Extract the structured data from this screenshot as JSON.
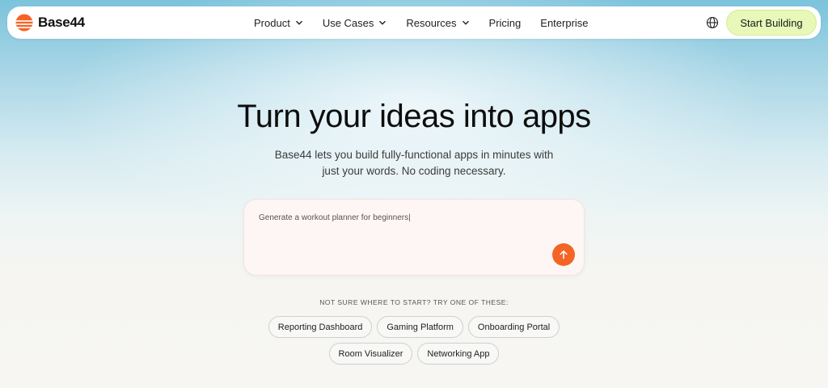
{
  "brand": {
    "name": "Base44",
    "logo_icon": "sun-stripes-logo",
    "accent": "#f46425"
  },
  "nav": {
    "items": [
      {
        "label": "Product",
        "dropdown": true
      },
      {
        "label": "Use Cases",
        "dropdown": true
      },
      {
        "label": "Resources",
        "dropdown": true
      },
      {
        "label": "Pricing",
        "dropdown": false
      },
      {
        "label": "Enterprise",
        "dropdown": false
      }
    ],
    "language_icon": "globe-icon",
    "cta_label": "Start Building",
    "cta_color": "#e7f8b9"
  },
  "hero": {
    "title": "Turn your ideas into apps",
    "subtitle": "Base44 lets you build fully-functional apps in minutes with just your words. No coding necessary."
  },
  "prompt": {
    "value": "Generate a workout planner for beginners|",
    "send_icon": "arrow-up-icon"
  },
  "suggestions": {
    "hint": "NOT SURE WHERE TO START? TRY ONE OF THESE:",
    "row1": [
      "Reporting Dashboard",
      "Gaming Platform",
      "Onboarding Portal"
    ],
    "row2": [
      "Room Visualizer",
      "Networking App"
    ]
  }
}
